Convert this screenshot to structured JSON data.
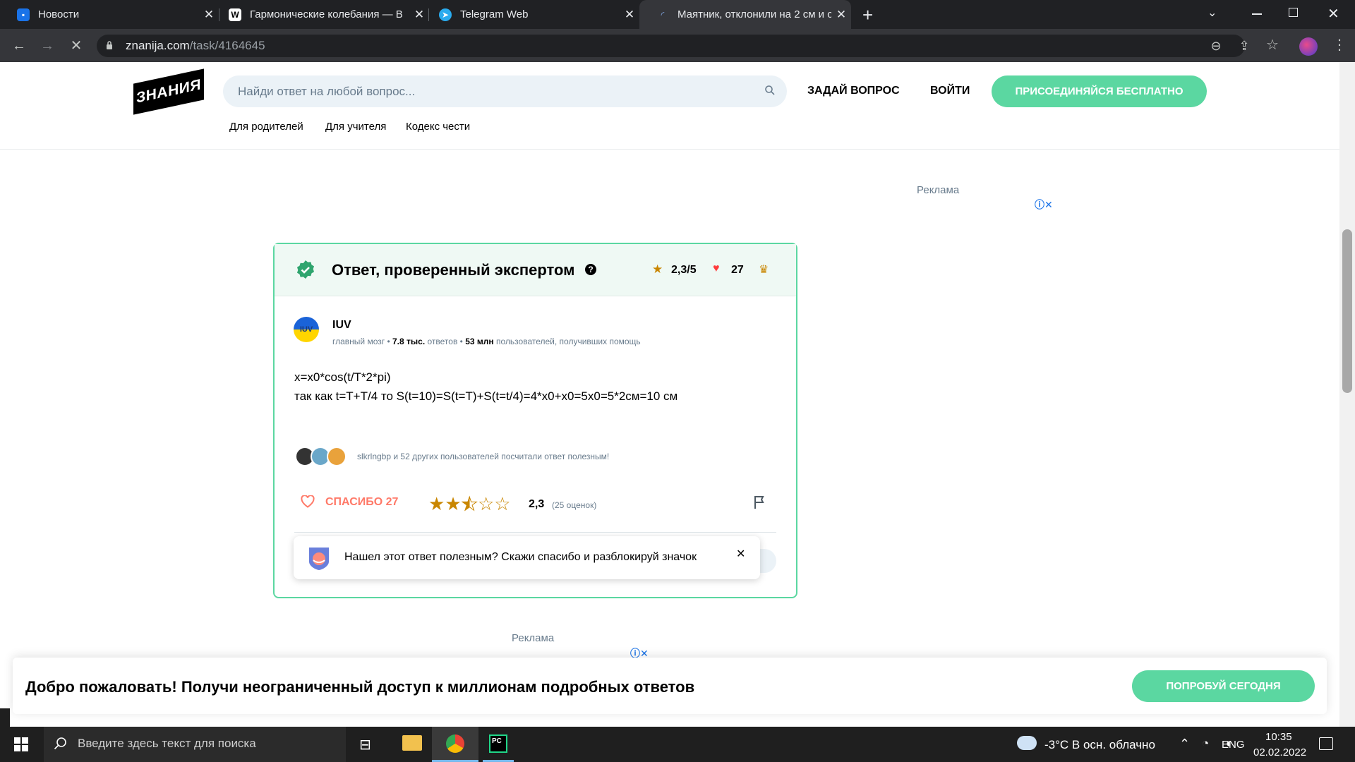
{
  "browser": {
    "tabs": [
      {
        "title": "Новости",
        "icon": "chat-icon",
        "color": "#1a73e8"
      },
      {
        "title": "Гармонические колебания — В",
        "icon": "wikipedia-icon",
        "color": "#ffffff"
      },
      {
        "title": "Telegram Web",
        "icon": "telegram-icon",
        "color": "#2aabee"
      },
      {
        "title": "Маятник, отклонили на 2 см и с",
        "icon": "loading-icon",
        "color": "#8ab4f8",
        "active": true
      }
    ],
    "new_tab": "+",
    "url_host": "znanija.com",
    "url_path": "/task/4164645"
  },
  "site": {
    "logo": "ЗНАНИЯ",
    "search_placeholder": "Найди ответ на любой вопрос...",
    "ask": "ЗАДАЙ ВОПРОС",
    "login": "ВОЙТИ",
    "join": "ПРИСОЕДИНЯЙСЯ БЕСПЛАТНО",
    "sublinks": [
      "Для родителей",
      "Для учителя",
      "Кодекс чести"
    ],
    "ad_label": "Реклама",
    "ad_label_2": "Реклама"
  },
  "answer": {
    "title": "Ответ, проверенный экспертом",
    "rating": "2,3/5",
    "likes": "27",
    "author": "IUV",
    "author_avatar_text": "IUV",
    "rank": "главный мозг",
    "answers_count": "7.8 тыс.",
    "answers_label": "ответов",
    "helped_count": "53 млн",
    "helped_label": "пользователей, получивших помощь",
    "lines": [
      "x=x0*cos(t/T*2*pi)",
      "так как t=T+T/4 то S(t=10)=S(t=T)+S(t=t/4)=4*x0+x0=5x0=5*2см=10 см"
    ],
    "helpful_text": "slkrlngbp и 52 других пользователей посчитали ответ полезным!",
    "thanks": "СПАСИБО 27",
    "stars_value": 2.3,
    "rate": "2,3",
    "rate_count": "(25 оценок)",
    "toast": "Нашел этот ответ полезным? Скажи спасибо и разблокируй значок"
  },
  "banner": {
    "text": "Добро пожаловать! Получи неограниченный доступ к миллионам подробных ответов",
    "button": "ПОПРОБУЙ СЕГОДНЯ"
  },
  "taskbar": {
    "search_placeholder": "Введите здесь текст для поиска",
    "weather": "-3°C  В осн. облачно",
    "lang": "ENG",
    "time": "10:35",
    "date": "02.02.2022"
  }
}
